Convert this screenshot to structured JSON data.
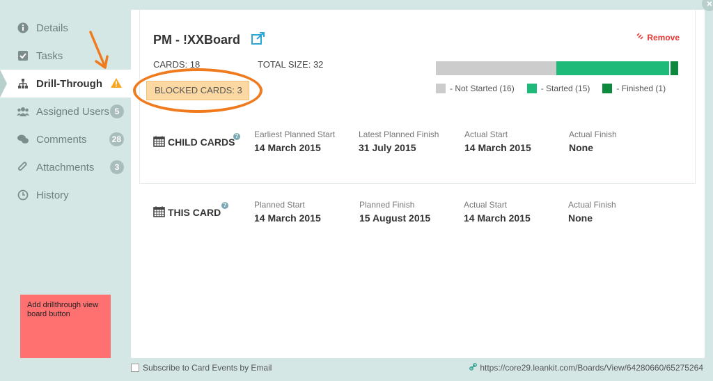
{
  "sidebar": {
    "items": [
      {
        "label": "Details",
        "icon": "info-icon"
      },
      {
        "label": "Tasks",
        "icon": "checkbox-icon"
      },
      {
        "label": "Drill-Through",
        "icon": "hierarchy-icon",
        "active": true
      },
      {
        "label": "Assigned Users",
        "icon": "users-icon",
        "badge": "5"
      },
      {
        "label": "Comments",
        "icon": "comment-icon",
        "badge": "28"
      },
      {
        "label": "Attachments",
        "icon": "paperclip-icon",
        "badge": "3"
      },
      {
        "label": "History",
        "icon": "clock-icon"
      }
    ]
  },
  "note": {
    "text": "Add drillthrough view board button"
  },
  "card": {
    "title": "PM - !XXBoard",
    "remove_label": "Remove",
    "cards_count": "CARDS: 18",
    "total_size": "TOTAL SIZE: 32",
    "blocked_cards": "BLOCKED CARDS: 3"
  },
  "progress": {
    "not_started": 16,
    "started": 15,
    "finished": 1,
    "colors": {
      "not_started": "#cccccc",
      "started": "#1dba7a",
      "finished": "#0e8a3e"
    },
    "legend": [
      "- Not Started (16)",
      "- Started (15)",
      "- Finished (1)"
    ]
  },
  "child_cards": {
    "label": "CHILD CARDS",
    "fields": [
      {
        "label": "Earliest Planned Start",
        "value": "14 March 2015"
      },
      {
        "label": "Latest Planned Finish",
        "value": "31 July 2015"
      },
      {
        "label": "Actual Start",
        "value": "14 March 2015"
      },
      {
        "label": "Actual Finish",
        "value": "None"
      }
    ]
  },
  "this_card": {
    "label": "THIS CARD",
    "fields": [
      {
        "label": "Planned Start",
        "value": "14 March 2015"
      },
      {
        "label": "Planned Finish",
        "value": "15 August 2015"
      },
      {
        "label": "Actual Start",
        "value": "14 March 2015"
      },
      {
        "label": "Actual Finish",
        "value": "None"
      }
    ]
  },
  "footer": {
    "subscribe_label": "Subscribe to Card Events by Email",
    "url": "https://core29.leankit.com/Boards/View/64280660/65275264"
  }
}
